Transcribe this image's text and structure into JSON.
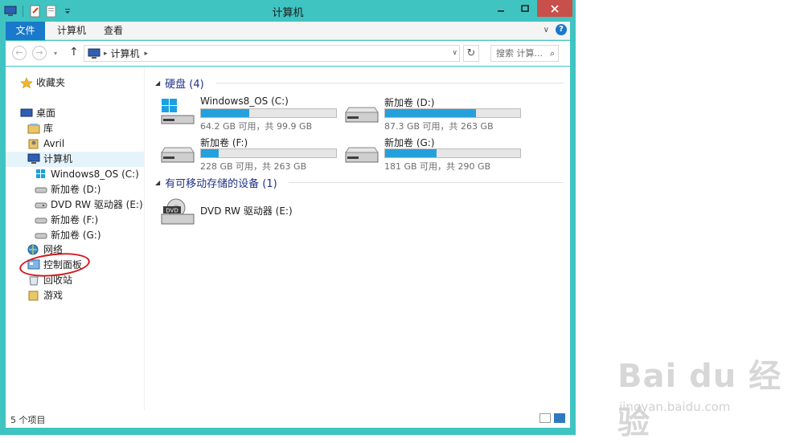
{
  "titlebar": {
    "title": "计算机"
  },
  "ribbon": {
    "tabs": [
      "文件",
      "计算机",
      "查看"
    ]
  },
  "address": {
    "path": "计算机",
    "search_placeholder": "搜索 计算..."
  },
  "sidebar": {
    "favorites": "收藏夹",
    "desktop": "桌面",
    "library": "库",
    "user": "Avril",
    "computer": "计算机",
    "computer_children": [
      "Windows8_OS (C:)",
      "新加卷 (D:)",
      "DVD RW 驱动器 (E:)",
      "新加卷 (F:)",
      "新加卷 (G:)"
    ],
    "network": "网络",
    "control_panel": "控制面板",
    "recycle_bin": "回收站",
    "games": "游戏"
  },
  "content": {
    "hard_disks_title": "硬盘 (4)",
    "removable_title": "有可移动存储的设备 (1)",
    "drives": [
      {
        "name": "Windows8_OS (C:)",
        "size_text": "64.2 GB 可用，共 99.9 GB",
        "used_fraction": 0.36
      },
      {
        "name": "新加卷 (D:)",
        "size_text": "87.3 GB 可用，共 263 GB",
        "used_fraction": 0.67
      },
      {
        "name": "新加卷 (F:)",
        "size_text": "228 GB 可用，共 263 GB",
        "used_fraction": 0.13
      },
      {
        "name": "新加卷 (G:)",
        "size_text": "181 GB 可用，共 290 GB",
        "used_fraction": 0.38
      }
    ],
    "dvd": {
      "name": "DVD RW 驱动器 (E:)",
      "badge": "DVD"
    }
  },
  "status": {
    "text": "5 个项目"
  },
  "watermark": {
    "logo": "Bai du 经验",
    "url": "jingyan.baidu.com"
  },
  "colors": {
    "titlebar": "#3fc4c2",
    "file_tab": "#1979ca",
    "close": "#c7504b",
    "bar_fill": "#26a0da",
    "annotation": "#d3171d"
  }
}
